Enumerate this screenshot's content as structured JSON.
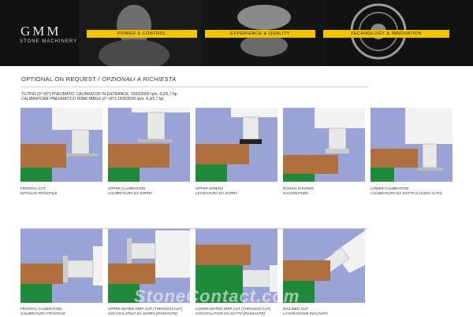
{
  "brand": {
    "logo": "GMM",
    "sub": "STONE MACHINERY"
  },
  "banner": {
    "ribbons": [
      "POWER & CONTROL",
      "EXPERIENCE & QUALITY",
      "TECHNOLOGY & INNOVATION"
    ]
  },
  "heading": {
    "en": "OPTIONAL ON REQUEST",
    "sep": "/",
    "it": "OPZIONALI A RICHIESTA"
  },
  "subtitle": {
    "en": "TILTING (0°-90°) PNEUMATIC CALIBRATOR IN ENTRANCE, 1500/3000 rpm, 4,3/5,7 hp",
    "it": "CALIBRATORE PNEUMATICO RIBALTABILE (0°-90°) 1500/3000 rpm, 4,3/5,7 hp"
  },
  "row1": [
    {
      "en": "FRONTAL CUT",
      "it": "INTAGLIO FRONTALE"
    },
    {
      "en": "UPPER CALIBRATION",
      "it": "CALIBRATURA DA SOPRA"
    },
    {
      "en": "UPPER HONING",
      "it": "LEVIGATURA DA SOPRA"
    },
    {
      "en": "ROUGH SHAPING",
      "it": "SAGOMATURA"
    },
    {
      "en": "LOWER CALIBRATION",
      "it": "CALIBRATURA DA SOTTO (LUCIDO ALTO)"
    }
  ],
  "row2": [
    {
      "en": "FRONTAL CALIBRATION",
      "it": "CALIBRATURA FRONTALE"
    },
    {
      "en": "UPPER WATER DRIP CUT (THROUGH CUT)",
      "it": "GOCCIOLATOIO DA SOPRA (PASSANTE)"
    },
    {
      "en": "LOWER WATER DRIP CUT (THROUGH CUT)",
      "it": "GOCCIOLATOIO DA SOTTO (PASSANTE)"
    },
    {
      "en": "INCLINED CUT",
      "it": "LAVORAZIONE INCLINATA"
    }
  ],
  "watermark": "StoneContact.com",
  "colors": {
    "ribbon": "#f3c400",
    "tile_bg": "#9aa3d6",
    "stone": "#b0703e",
    "table": "#1f8a3a",
    "head": "#f2f2f2"
  }
}
